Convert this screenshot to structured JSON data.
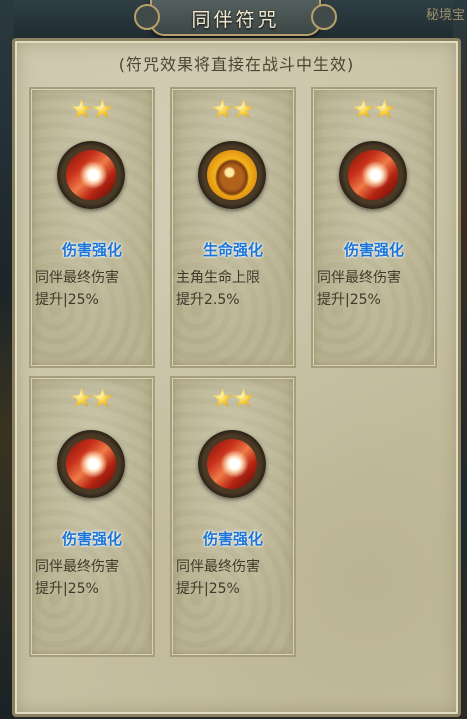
{
  "header": {
    "title": "同伴符咒",
    "corner_text": "秘境宝"
  },
  "panel": {
    "subtitle": "(符咒效果将直接在战斗中生效)"
  },
  "cards": [
    {
      "name": "伤害强化",
      "line1": "同伴最终伤害",
      "line2": "提升|25%",
      "stars": 2,
      "icon": "damage-slash-icon"
    },
    {
      "name": "生命强化",
      "line1": "主角生命上限",
      "line2": "提升2.5%",
      "stars": 2,
      "icon": "flexed-arm-icon"
    },
    {
      "name": "伤害强化",
      "line1": "同伴最终伤害",
      "line2": "提升|25%",
      "stars": 2,
      "icon": "damage-slash-icon"
    },
    {
      "name": "伤害强化",
      "line1": "同伴最终伤害",
      "line2": "提升|25%",
      "stars": 2,
      "icon": "damage-slash-icon"
    },
    {
      "name": "伤害强化",
      "line1": "同伴最终伤害",
      "line2": "提升|25%",
      "stars": 2,
      "icon": "damage-slash-icon"
    }
  ],
  "colors": {
    "name_blue": "#1b74d8",
    "star_gold": "#f6c52a",
    "panel_bg": "#c8c2a4"
  }
}
